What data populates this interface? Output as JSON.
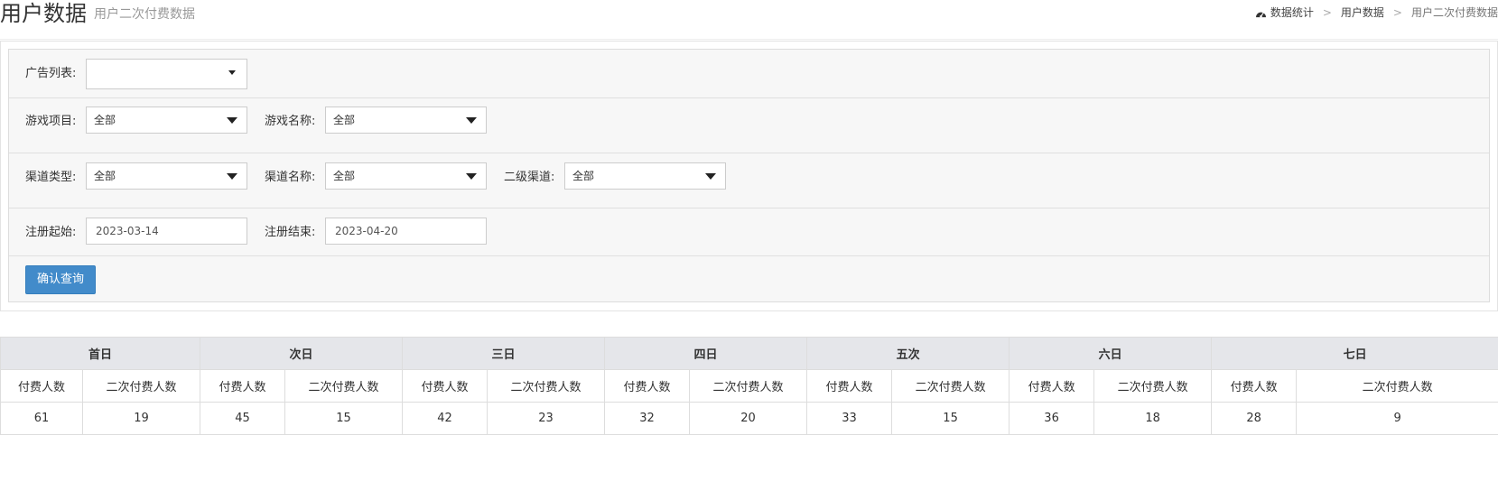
{
  "header": {
    "title": "用户数据",
    "subtitle": "用户二次付费数据",
    "breadcrumb": [
      "数据统计",
      "用户数据",
      "用户二次付费数据"
    ]
  },
  "filters": {
    "ad_list": {
      "label": "广告列表:",
      "value": ""
    },
    "game_project": {
      "label": "游戏项目:",
      "value": "全部"
    },
    "game_name": {
      "label": "游戏名称:",
      "value": "全部"
    },
    "channel_type": {
      "label": "渠道类型:",
      "value": "全部"
    },
    "channel_name": {
      "label": "渠道名称:",
      "value": "全部"
    },
    "sub_channel": {
      "label": "二级渠道:",
      "value": "全部"
    },
    "reg_start": {
      "label": "注册起始:",
      "value": "2023-03-14"
    },
    "reg_end": {
      "label": "注册结束:",
      "value": "2023-04-20"
    },
    "submit_label": "确认查询"
  },
  "table": {
    "groups": [
      "首日",
      "次日",
      "三日",
      "四日",
      "五次",
      "六日",
      "七日"
    ],
    "sub_headers": [
      "付费人数",
      "二次付费人数"
    ],
    "row": [
      "61",
      "19",
      "45",
      "15",
      "42",
      "23",
      "32",
      "20",
      "33",
      "15",
      "36",
      "18",
      "28",
      "9"
    ]
  },
  "colors": {
    "accent": "#428bca",
    "table_header_bg": "#e5e6ea",
    "panel_bg": "#f7f7f7"
  }
}
